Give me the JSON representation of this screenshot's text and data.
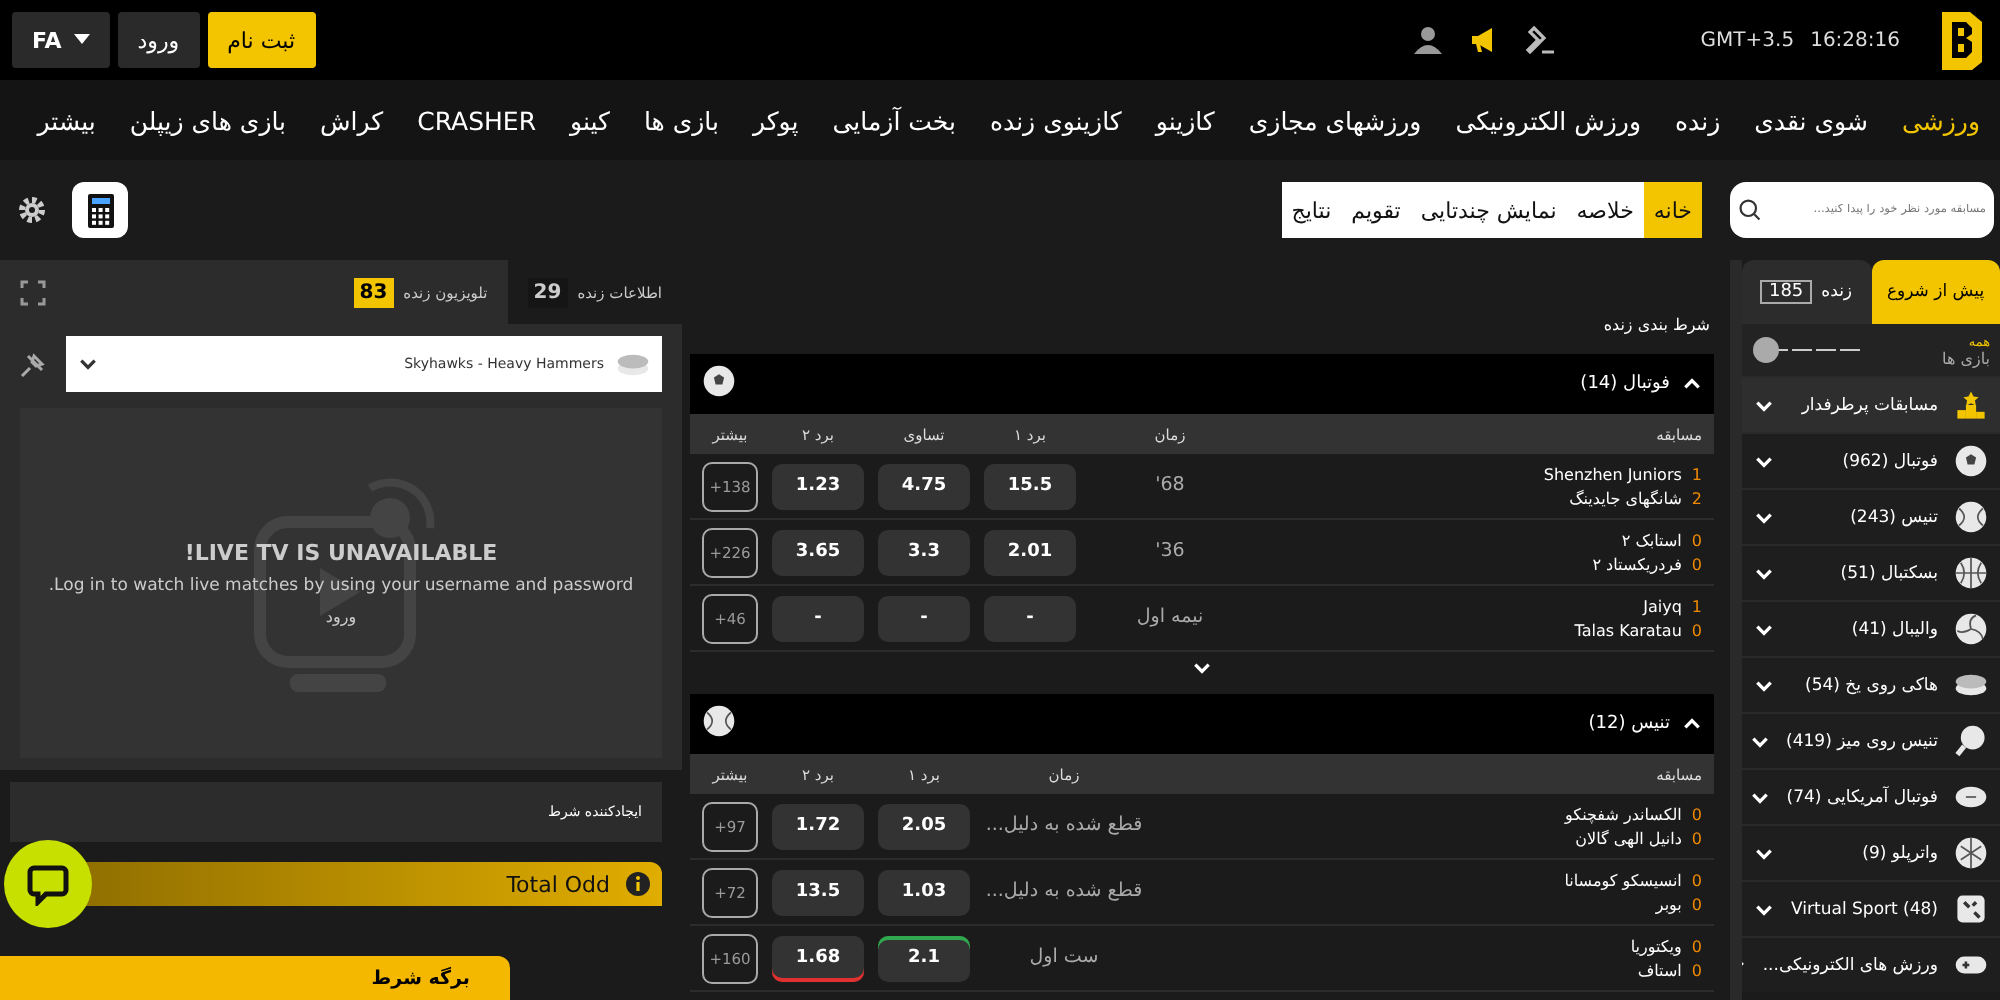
{
  "header": {
    "time": "16:28:16",
    "timezone": "GMT+3.5",
    "register_button": "ثبت نام",
    "login_button": "ورود",
    "language": "FA"
  },
  "nav": [
    {
      "label": "ورزشی",
      "selected": true
    },
    {
      "label": "شوی نقدی",
      "selected": false
    },
    {
      "label": "زنده",
      "selected": false
    },
    {
      "label": "ورزش الکترونیکی",
      "selected": false
    },
    {
      "label": "ورزشهای مجازی",
      "selected": false
    },
    {
      "label": "کازینو",
      "selected": false
    },
    {
      "label": "کازینوی زنده",
      "selected": false
    },
    {
      "label": "بخت آزمایی",
      "selected": false
    },
    {
      "label": "پوکر",
      "selected": false
    },
    {
      "label": "بازی ها",
      "selected": false
    },
    {
      "label": "کینو",
      "selected": false
    },
    {
      "label": "CRASHER",
      "selected": false
    },
    {
      "label": "کراش",
      "selected": false
    },
    {
      "label": "بازی های زیپلن",
      "selected": false
    },
    {
      "label": "بیشتر",
      "selected": false
    }
  ],
  "search": {
    "placeholder": "مسابقه مورد نظر خود را پیدا کنید..."
  },
  "view_tabs": [
    {
      "label": "خانه",
      "selected": true
    },
    {
      "label": "خلاصه",
      "selected": false
    },
    {
      "label": "نمایش چندتایی",
      "selected": false
    },
    {
      "label": "تقویم",
      "selected": false
    },
    {
      "label": "نتایج",
      "selected": false
    }
  ],
  "sidebar": {
    "tabs": [
      {
        "label": "پیش از شروع",
        "selected": true
      },
      {
        "label": "زنده",
        "count": "185",
        "selected": false
      }
    ],
    "filter": {
      "label": "همه",
      "caption": "بازی ها",
      "on": false
    },
    "items": [
      {
        "kind": "trophy",
        "label": "مسابقات پرطرفدار",
        "selected": true
      },
      {
        "kind": "football",
        "label": "فوتبال (962)",
        "selected": false
      },
      {
        "kind": "tennis",
        "label": "تنیس (243)",
        "selected": false
      },
      {
        "kind": "basketball",
        "label": "بسکتبال (51)",
        "selected": false
      },
      {
        "kind": "volleyball",
        "label": "والیبال (41)",
        "selected": false
      },
      {
        "kind": "hockey",
        "label": "هاکی روی یخ (54)",
        "selected": false
      },
      {
        "kind": "tabletennis",
        "label": "تنیس روی میز (419)",
        "selected": false
      },
      {
        "kind": "americanfootball",
        "label": "فوتبال آمریکایی (74)",
        "selected": false
      },
      {
        "kind": "waterpolo",
        "label": "واترپلو (9)",
        "selected": false
      },
      {
        "kind": "virtual",
        "label": "Virtual Sport (48)",
        "selected": false
      },
      {
        "kind": "esports",
        "label": "ورزش های الکترونیکی...",
        "selected": false
      }
    ]
  },
  "live": {
    "title": "شرط بندی زنده",
    "sports": [
      {
        "kind": "football",
        "name": "فوتبال",
        "count": "(14)",
        "columns": [
          "مسابقه",
          "زمان",
          "برد ۱",
          "تساوی",
          "برد ۲",
          "بیشتر"
        ],
        "rows": [
          {
            "teams": [
              {
                "score": "1",
                "name": "Shenzhen Juniors"
              },
              {
                "score": "2",
                "name": "شانگهای جایدینگ"
              }
            ],
            "time": "'68",
            "odds": [
              {
                "value": "15.5",
                "rising": false,
                "falling": false
              },
              {
                "value": "4.75",
                "rising": false,
                "falling": false
              },
              {
                "value": "1.23",
                "rising": false,
                "falling": false
              }
            ],
            "more": "+138"
          },
          {
            "teams": [
              {
                "score": "0",
                "name": "استابک ۲"
              },
              {
                "score": "0",
                "name": "فردریکستاد ۲"
              }
            ],
            "time": "'36",
            "odds": [
              {
                "value": "2.01",
                "rising": false,
                "falling": false
              },
              {
                "value": "3.3",
                "rising": false,
                "falling": false
              },
              {
                "value": "3.65",
                "rising": false,
                "falling": false
              }
            ],
            "more": "+226"
          },
          {
            "teams": [
              {
                "score": "1",
                "name": "Jaiyq"
              },
              {
                "score": "0",
                "name": "Talas Karatau"
              }
            ],
            "time": "نیمه اول",
            "odds": [
              {
                "value": "-",
                "rising": false,
                "falling": false
              },
              {
                "value": "-",
                "rising": false,
                "falling": false
              },
              {
                "value": "-",
                "rising": false,
                "falling": false
              }
            ],
            "more": "+46"
          }
        ],
        "expandable": true
      },
      {
        "kind": "tennis",
        "name": "تنیس",
        "count": "(12)",
        "columns": [
          "مسابقه",
          "زمان",
          "برد ۱",
          "برد ۲",
          "بیشتر"
        ],
        "rows": [
          {
            "teams": [
              {
                "score": "0",
                "name": "الکساندر شفچنکو"
              },
              {
                "score": "0",
                "name": "دانیل الهی گالان"
              }
            ],
            "time": "قطع شده به دلیل...",
            "odds": [
              {
                "value": "2.05",
                "rising": false,
                "falling": false
              },
              {
                "value": "1.72",
                "rising": false,
                "falling": false
              }
            ],
            "more": "+97"
          },
          {
            "teams": [
              {
                "score": "0",
                "name": "انسیسکو کومسانا"
              },
              {
                "score": "0",
                "name": "بوبر"
              }
            ],
            "time": "قطع شده به دلیل...",
            "odds": [
              {
                "value": "1.03",
                "rising": false,
                "falling": false
              },
              {
                "value": "13.5",
                "rising": false,
                "falling": false
              }
            ],
            "more": "+72"
          },
          {
            "teams": [
              {
                "score": "0",
                "name": "ویکتوریا"
              },
              {
                "score": "0",
                "name": "استاف"
              }
            ],
            "time": "ست اول",
            "odds": [
              {
                "value": "2.1",
                "rising": true,
                "falling": false
              },
              {
                "value": "1.68",
                "rising": false,
                "falling": true
              }
            ],
            "more": "+160"
          }
        ],
        "expandable": false
      }
    ]
  },
  "left_panel": {
    "tabs": [
      {
        "label": "اطلاعات زنده",
        "count": "29",
        "selected": false
      },
      {
        "label": "تلویزیون زنده",
        "count": "83",
        "selected": true
      }
    ],
    "match_select": {
      "value": "Skyhawks - Heavy Hammers"
    },
    "tv_message": {
      "title": "!LIVE TV IS UNAVAILABLE",
      "text": ".Log in to watch live matches by using your username and password",
      "link": "ورود"
    },
    "bet_builder": "ایجادکننده شرط",
    "total_odd": "Total Odd",
    "bet_slip": "برگه شرط"
  }
}
